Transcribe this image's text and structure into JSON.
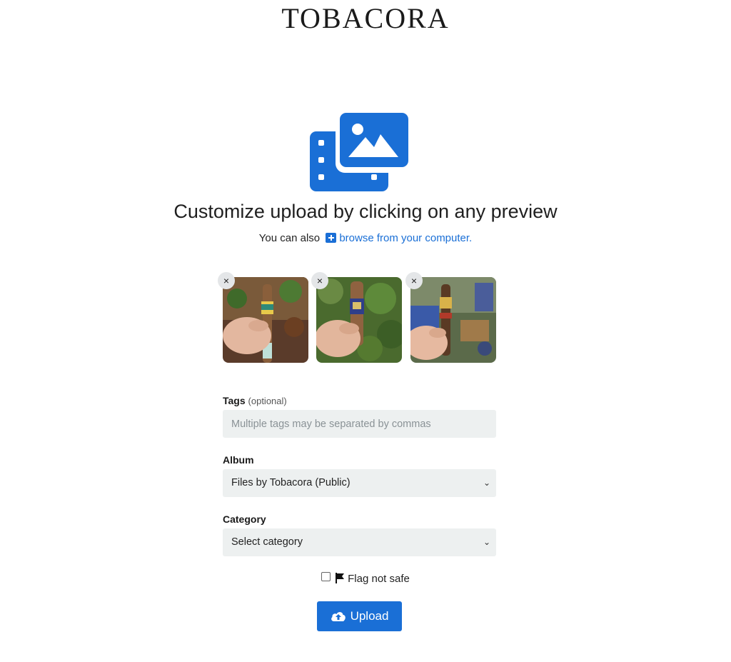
{
  "brand": {
    "name": "TOBACORA"
  },
  "hero": {
    "icon": "photo-video-icon",
    "color": "#1a6fd6"
  },
  "headline": "Customize upload by clicking on any preview",
  "subline": {
    "prefix": "You can also",
    "icon": "plus-square-icon",
    "link": "browse from your computer."
  },
  "previews": [
    {
      "remove_label": "×"
    },
    {
      "remove_label": "×"
    },
    {
      "remove_label": "×"
    }
  ],
  "form": {
    "tags": {
      "label": "Tags",
      "optional": "(optional)",
      "value": "",
      "placeholder": "Multiple tags may be separated by commas"
    },
    "album": {
      "label": "Album",
      "selected": "Files by Tobacora (Public)"
    },
    "category": {
      "label": "Category",
      "selected": "Select category"
    },
    "flag": {
      "label": "Flag not safe",
      "checked": false,
      "icon": "flag-icon"
    },
    "upload": {
      "label": "Upload",
      "icon": "cloud-upload-icon"
    }
  },
  "colors": {
    "accent": "#1a6fd6",
    "field_bg": "#edf0f0"
  }
}
